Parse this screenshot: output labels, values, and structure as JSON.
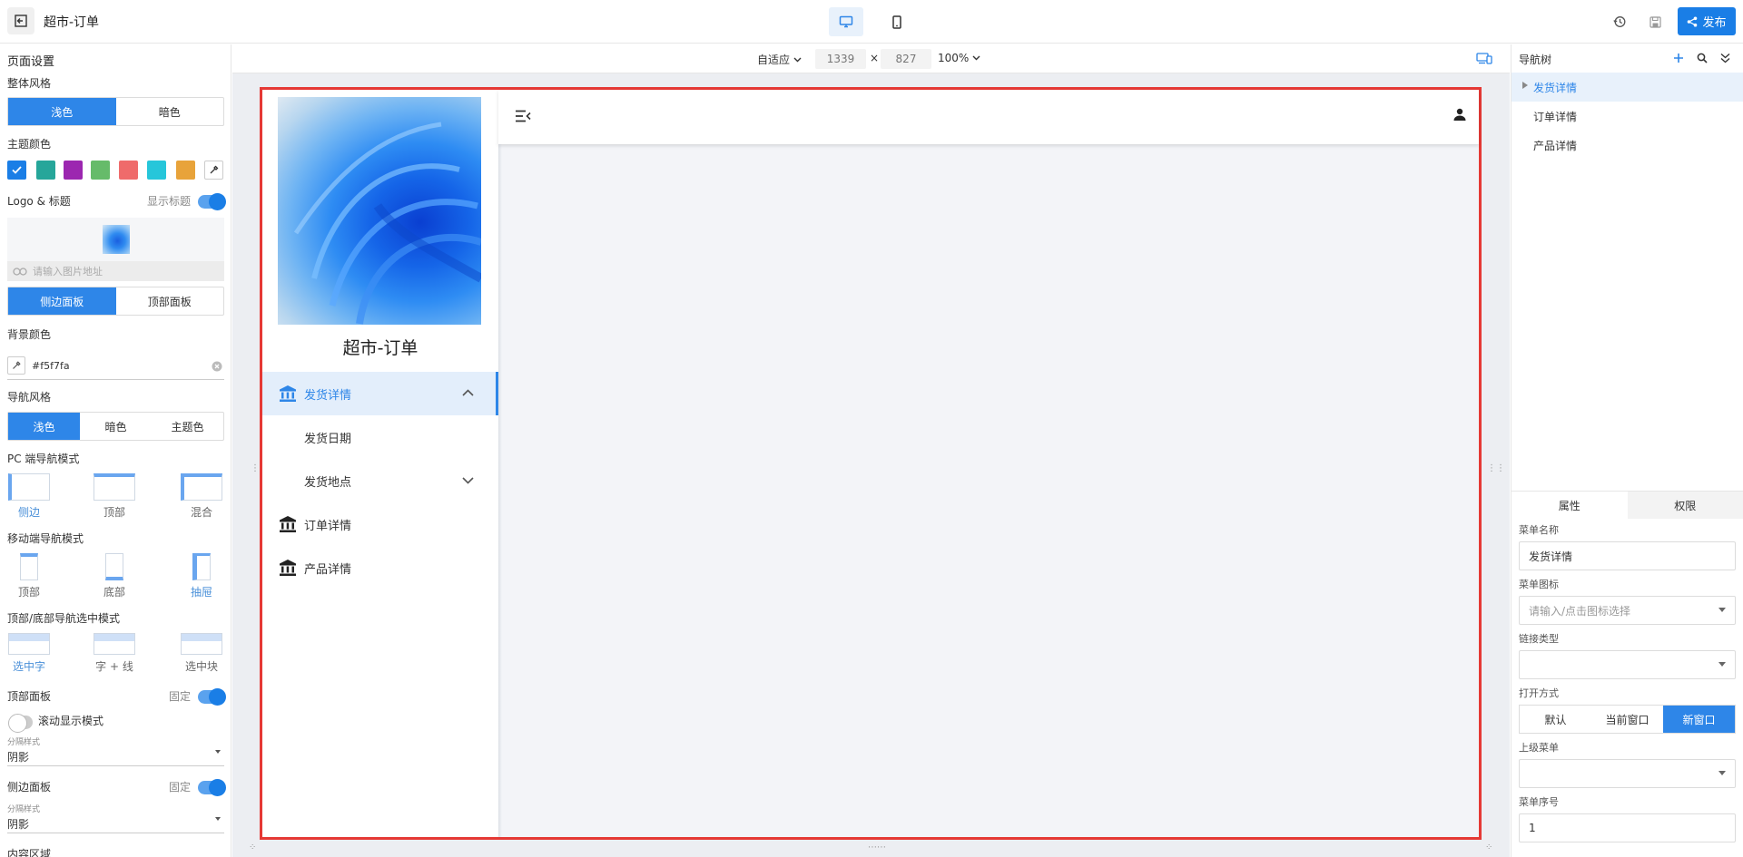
{
  "header": {
    "title": "超市-订单",
    "publish_label": "发布"
  },
  "left_panel": {
    "section_title": "页面设置",
    "style_label": "整体风格",
    "style_options": [
      "浅色",
      "暗色"
    ],
    "theme_color_label": "主题颜色",
    "theme_colors": [
      "#1a7ee6",
      "#26a69a",
      "#9c27b0",
      "#66bb6a",
      "#ef6b6b",
      "#26c6da",
      "#e8a33a"
    ],
    "logo_title_label": "Logo & 标题",
    "show_title_label": "显示标题",
    "image_placeholder": "请输入图片地址",
    "panel_options": [
      "侧边面板",
      "顶部面板"
    ],
    "bg_color_label": "背景颜色",
    "bg_color_value": "#f5f7fa",
    "nav_style_label": "导航风格",
    "nav_style_options": [
      "浅色",
      "暗色",
      "主题色"
    ],
    "pc_nav_label": "PC 端导航模式",
    "pc_nav_modes": [
      "侧边",
      "顶部",
      "混合"
    ],
    "mobile_nav_label": "移动端导航模式",
    "mobile_nav_modes": [
      "顶部",
      "底部",
      "抽屉"
    ],
    "select_mode_label": "顶部/底部导航选中模式",
    "select_modes": [
      "选中字",
      "字 + 线",
      "选中块"
    ],
    "top_panel_label": "顶部面板",
    "fixed_label": "固定",
    "scroll_label": "滚动显示模式",
    "divider_label": "分隔样式",
    "divider_value": "阴影",
    "side_panel_label": "侧边面板",
    "fixed_label2": "固定",
    "divider_label2": "分隔样式",
    "divider_value2": "阴影",
    "content_label": "内容区域"
  },
  "canvas": {
    "fit_label": "自适应",
    "width": "1339",
    "times": "×",
    "height": "827",
    "zoom": "100%"
  },
  "preview": {
    "app_title": "超市-订单",
    "menu": [
      {
        "label": "发货详情"
      },
      {
        "label": "发货日期"
      },
      {
        "label": "发货地点"
      },
      {
        "label": "订单详情"
      },
      {
        "label": "产品详情"
      }
    ]
  },
  "right_panel": {
    "title": "导航树",
    "tree": [
      "发货详情",
      "订单详情",
      "产品详情"
    ],
    "tabs": [
      "属性",
      "权限"
    ],
    "menu_name_label": "菜单名称",
    "menu_name_value": "发货详情",
    "menu_icon_label": "菜单图标",
    "menu_icon_placeholder": "请输入/点击图标选择",
    "link_type_label": "链接类型",
    "open_mode_label": "打开方式",
    "open_modes": [
      "默认",
      "当前窗口",
      "新窗口"
    ],
    "parent_menu_label": "上级菜单",
    "menu_order_label": "菜单序号",
    "menu_order_value": "1"
  },
  "colors": {
    "accent": "#1a7ee6",
    "frame_border": "#e53935"
  }
}
